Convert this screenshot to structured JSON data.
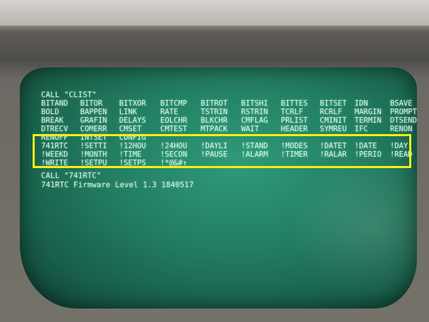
{
  "colors": {
    "screen": "#237f63",
    "text": "#d6f5e6",
    "highlight": "#f3ee1a",
    "bezel": "#7d7a74"
  },
  "terminal": {
    "call_clist": "CALL \"CLIST\"",
    "clist_rows": [
      [
        "BITAND",
        "BITOR",
        "BITXOR",
        "BITCMP",
        "BITROT",
        "BITSHI",
        "BITTES",
        "BITSET",
        "IDN",
        "BSAVE"
      ],
      [
        "BOLD",
        "BAPPEN",
        "LINK",
        "RATE",
        "TSTRIN",
        "RSTRIN",
        "TCRLF",
        "RCRLF",
        "MARGIN",
        "PROMPT"
      ],
      [
        "BREAK",
        "GRAFIN",
        "DELAYS",
        "EOLCHR",
        "BLKCHR",
        "CMFLAG",
        "PRLIST",
        "CMINIT",
        "TERMIN",
        "DTSEND"
      ],
      [
        "DTRECV",
        "COMERR",
        "CMSET",
        "CMTEST",
        "MTPACK",
        "WAIT",
        "HEADER",
        "SYMREU",
        "IFC",
        "RENON"
      ],
      [
        "RENOFF",
        "INTSET",
        "CONFIG",
        "",
        "",
        "",
        "",
        "",
        "",
        ""
      ]
    ],
    "rtc_rows": [
      [
        "741RTC",
        "!SETTI",
        "!12HOU",
        "!24HOU",
        "!DAYLI",
        "!STAND",
        "!MODES",
        "!DATET",
        "!DATE",
        "!DAY"
      ],
      [
        "!WEEKD",
        "!MONTH",
        "!TIME",
        "!SECON",
        "!PAUSE",
        "!ALARM",
        "!TIMER",
        "!RALAR",
        "!PERIO",
        "!READ"
      ],
      [
        "!WRITE",
        "!SETPU",
        "!SETPS",
        "!*@&#↑",
        "",
        "",
        "",
        "",
        "",
        ""
      ]
    ],
    "call_741rtc": "CALL \"741RTC\"",
    "firmware_line": "741RTC Firmware Level 1.3 1840517"
  }
}
